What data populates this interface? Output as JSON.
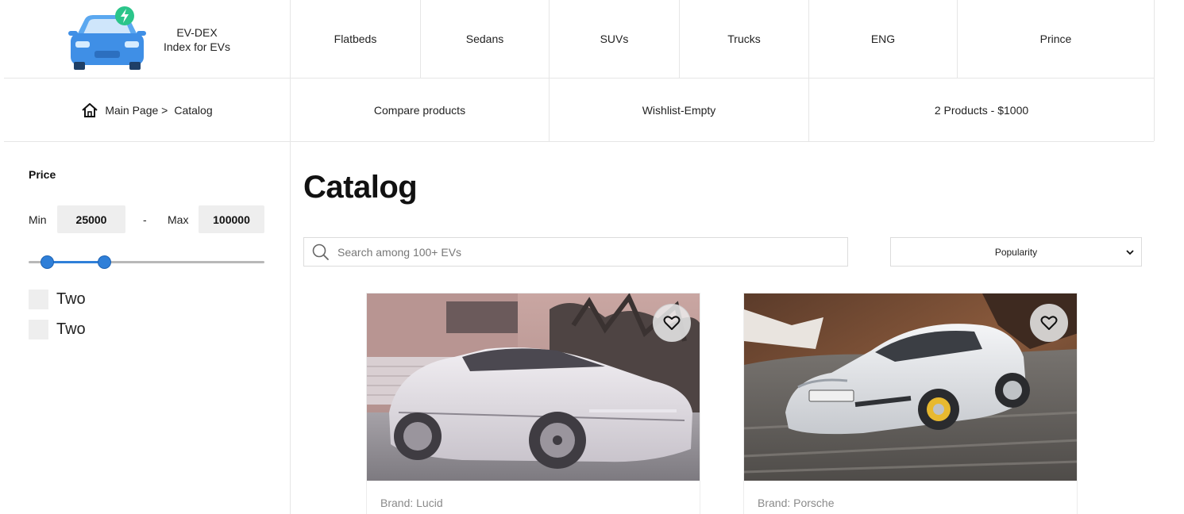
{
  "logo": {
    "line1": "EV-DEX",
    "line2": "Index for EVs",
    "icon": "car-charging-icon"
  },
  "nav": {
    "items": [
      "Flatbeds",
      "Sedans",
      "SUVs",
      "Trucks",
      "ENG",
      "Prince"
    ]
  },
  "breadcrumb": {
    "home": "Main Page >",
    "current": "Catalog",
    "icon": "home-icon"
  },
  "bar": {
    "compare": "Compare products",
    "wishlist": "Wishlist-Empty",
    "cart": "2 Products - $1000"
  },
  "filters": {
    "price_title": "Price",
    "min_label": "Min",
    "separator": "-",
    "max_label": "Max",
    "min_value": "25000",
    "max_value": "100000",
    "slider_low_fraction": 0.08,
    "slider_high_fraction": 0.32,
    "checkboxes": [
      "Two",
      "Two"
    ]
  },
  "catalog": {
    "title": "Catalog",
    "search_placeholder": "Search among 100+ EVs",
    "sort_selected": "Popularity"
  },
  "products": [
    {
      "brand": "Brand: Lucid",
      "image": "white sedan parked by palms"
    },
    {
      "brand": "Brand: Porsche",
      "image": "white sports car driving on road"
    }
  ],
  "colors": {
    "accent": "#2f7fd8",
    "border": "#e6e6e6",
    "field": "#eeeeee"
  }
}
